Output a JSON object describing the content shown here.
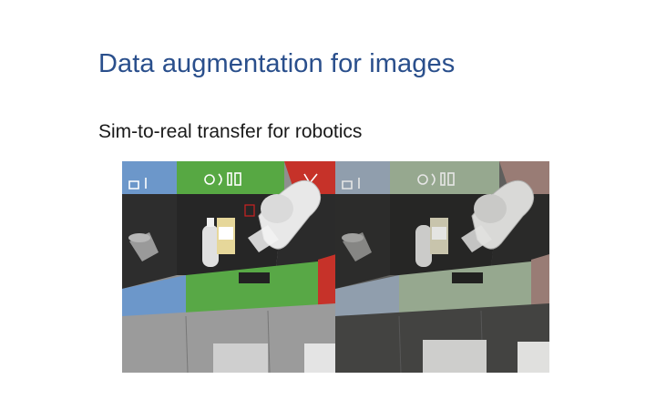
{
  "slide": {
    "title": "Data augmentation for images",
    "subtitle": "Sim-to-real transfer for robotics"
  },
  "panels": [
    {
      "kind": "simulated",
      "description_hidden": true
    },
    {
      "kind": "real",
      "description_hidden": true
    }
  ],
  "colors": {
    "title": "#2a4f8c",
    "bin_blue": "#6f97c9",
    "bin_green": "#5ba545",
    "bin_red": "#c9322b"
  }
}
